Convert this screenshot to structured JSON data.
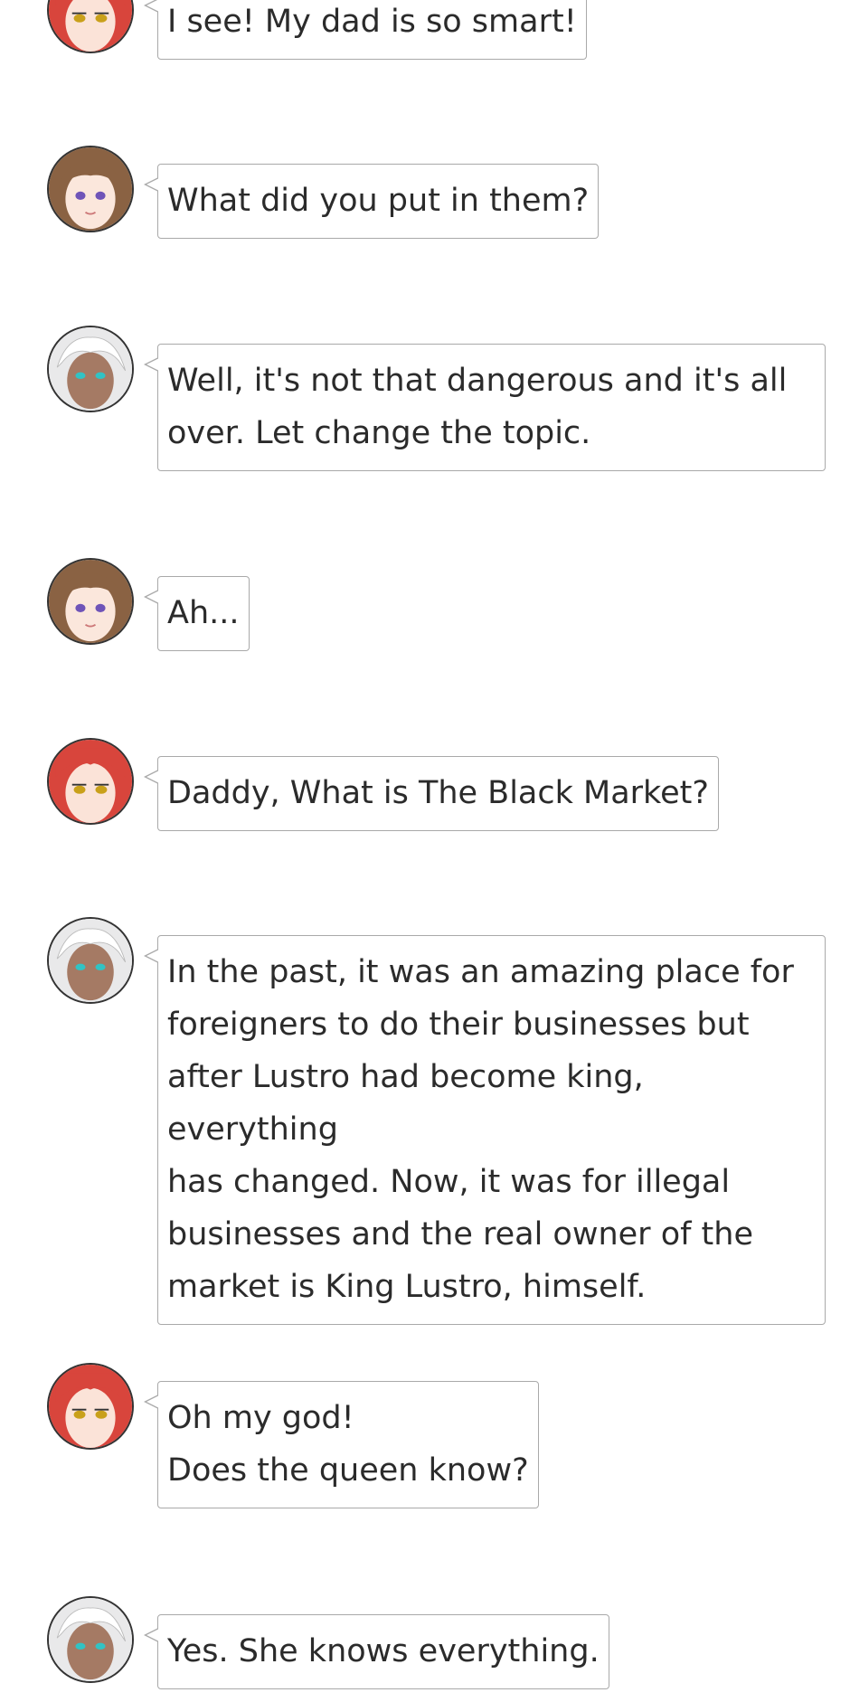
{
  "characters": {
    "daughter": {
      "name": "red-haired girl",
      "hair": "#d8453c",
      "skin": "#fbe3d8",
      "eye": "#c9a01a"
    },
    "mother": {
      "name": "brown-haired woman",
      "hair": "#8a6243",
      "skin": "#fbe7dc",
      "eye": "#6f54b8"
    },
    "father": {
      "name": "white-haired man",
      "hair": "#e9e9ea",
      "skin": "#a57a64",
      "eye": "#31c3c4"
    }
  },
  "messages": [
    {
      "speaker": "daughter",
      "text": "I see! My dad is so smart!"
    },
    {
      "speaker": "mother",
      "text": "What did you put in them?"
    },
    {
      "speaker": "father",
      "text": "Well, it's not that dangerous and it's all\nover. Let change the topic."
    },
    {
      "speaker": "mother",
      "text": "Ah..."
    },
    {
      "speaker": "daughter",
      "text": "Daddy, What is The Black Market?"
    },
    {
      "speaker": "father",
      "text": "In the past, it was an amazing place for\nforeigners to do their businesses but\nafter Lustro had become king, everything\nhas changed. Now, it was for illegal\nbusinesses and the real owner of the\nmarket is King Lustro, himself."
    },
    {
      "speaker": "daughter",
      "text": "Oh my god!\nDoes the queen know?"
    },
    {
      "speaker": "father",
      "text": "Yes. She knows everything."
    }
  ]
}
